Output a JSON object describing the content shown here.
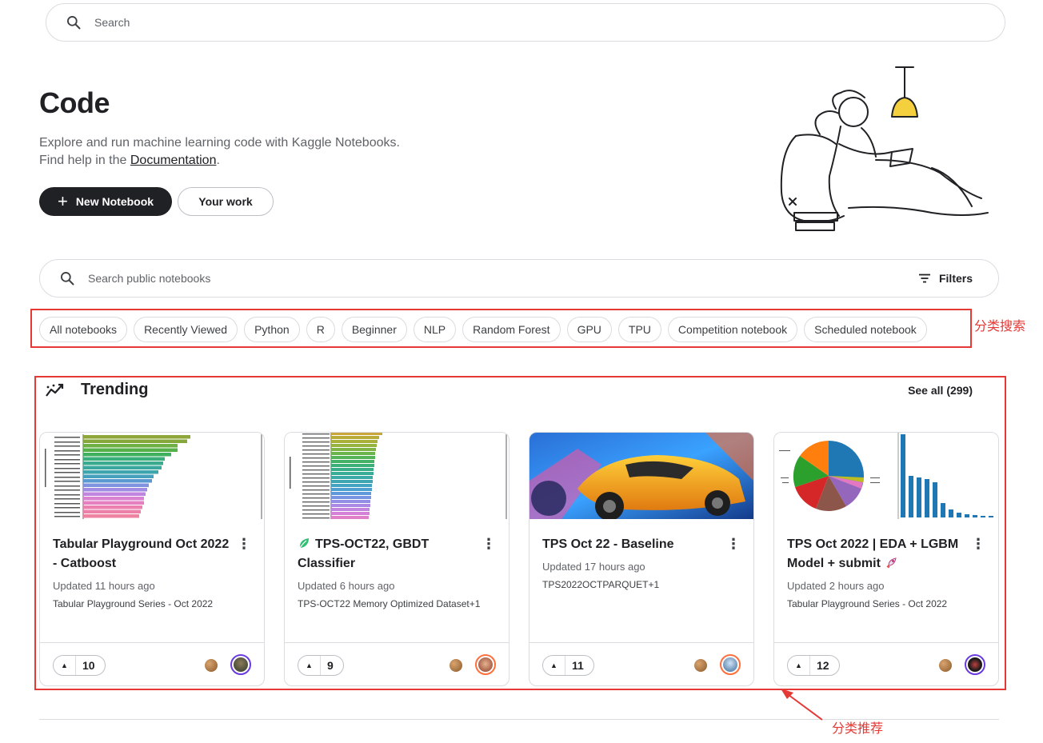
{
  "top_search": {
    "placeholder": "Search"
  },
  "hero": {
    "title": "Code",
    "desc_line1": "Explore and run machine learning code with Kaggle Notebooks.",
    "desc_line2_prefix": "Find help in the ",
    "doc_link": "Documentation",
    "desc_line2_suffix": ".",
    "new_notebook_label": "New Notebook",
    "your_work_label": "Your work"
  },
  "notebook_search": {
    "placeholder": "Search public notebooks",
    "filters_label": "Filters"
  },
  "chips": [
    "All notebooks",
    "Recently Viewed",
    "Python",
    "R",
    "Beginner",
    "NLP",
    "Random Forest",
    "GPU",
    "TPU",
    "Competition notebook",
    "Scheduled notebook"
  ],
  "annotations": {
    "chips_note": "分类搜索",
    "trending_note": "分类推荐"
  },
  "trending": {
    "title": "Trending",
    "see_all": "See all (299)",
    "cards": [
      {
        "title_l1": "Tabular Playground Oct 2022",
        "title_l2": "- Catboost",
        "updated": "Updated 11 hours ago",
        "dataset": "Tabular Playground Series - Oct 2022",
        "votes": "10",
        "thumb": "bar-chart-green-pink"
      },
      {
        "title_l1": "TPS-OCT22, GBDT",
        "title_l2": "Classifier",
        "updated": "Updated 6 hours ago",
        "dataset": "TPS-OCT22 Memory Optimized Dataset+1",
        "votes": "9",
        "thumb": "bar-chart-yellow-blue",
        "title_icon": "leaf-icon"
      },
      {
        "title_l1": "TPS Oct 22 - Baseline",
        "title_l2": "",
        "updated": "Updated 17 hours ago",
        "dataset": "TPS2022OCTPARQUET+1",
        "votes": "11",
        "thumb": "rocket-league-car"
      },
      {
        "title_l1": "TPS Oct 2022 | EDA + LGBM",
        "title_l2": "Model + submit",
        "updated": "Updated 2 hours ago",
        "dataset": "Tabular Playground Series - Oct 2022",
        "votes": "12",
        "thumb": "pie-and-bar-chart",
        "title_icon": "rocket-icon"
      }
    ]
  }
}
